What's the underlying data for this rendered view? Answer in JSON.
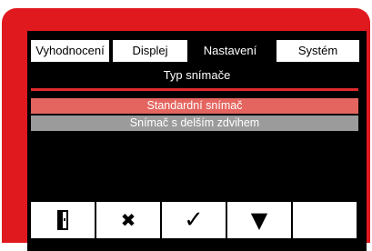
{
  "tabs": [
    {
      "label": "Vyhodnocení",
      "active": false
    },
    {
      "label": "Displej",
      "active": false
    },
    {
      "label": "Nastavení",
      "active": true
    },
    {
      "label": "Systém",
      "active": false
    }
  ],
  "section": {
    "title": "Typ snímače"
  },
  "options": [
    {
      "label": "Standardní snímač",
      "selected": true
    },
    {
      "label": "Snímač s delším zdvihem",
      "selected": false
    }
  ],
  "softkeys": [
    {
      "icon": "exit-door-icon"
    },
    {
      "icon": "cancel-x-icon",
      "glyph": "✖"
    },
    {
      "icon": "confirm-check-icon",
      "glyph": "✓"
    },
    {
      "icon": "down-arrow-icon",
      "glyph": "▼"
    },
    {
      "icon": "empty"
    }
  ],
  "colors": {
    "device_red": "#e0191f",
    "selected_row": "#e4655f",
    "unselected_row": "#9b9b9b",
    "screen_bg": "#000000"
  }
}
